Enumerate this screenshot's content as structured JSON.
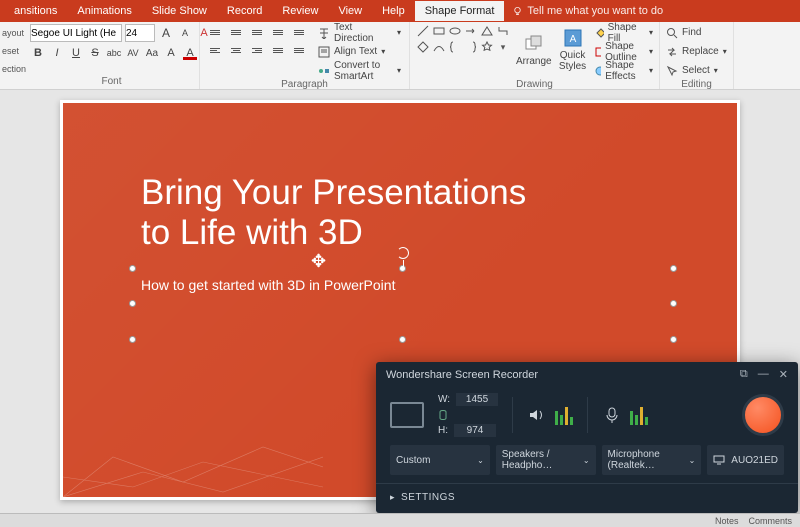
{
  "tabs": {
    "items": [
      "ansitions",
      "Animations",
      "Slide Show",
      "Record",
      "Review",
      "View",
      "Help",
      "Shape Format"
    ],
    "active_index": 7,
    "tell_me": "Tell me what you want to do"
  },
  "left_fragment": {
    "a": "ayout",
    "b": "eset",
    "c": "ection"
  },
  "font": {
    "family": "Segoe UI Light (He",
    "size": "24",
    "label": "Font",
    "btns": {
      "increase": "A",
      "decrease": "A",
      "clear": "A",
      "bold": "B",
      "italic": "I",
      "underline": "U",
      "strike": "S",
      "shadow": "abc",
      "spacing": "AV",
      "case": "Aa",
      "highlight": "A",
      "fontcolor": "A"
    }
  },
  "paragraph": {
    "label": "Paragraph",
    "text_direction": "Text Direction",
    "align_text": "Align Text",
    "convert_smartart": "Convert to SmartArt"
  },
  "drawing": {
    "label": "Drawing",
    "arrange": "Arrange",
    "quick_styles": "Quick Styles",
    "shape_fill": "Shape Fill",
    "shape_outline": "Shape Outline",
    "shape_effects": "Shape Effects"
  },
  "editing": {
    "label": "Editing",
    "find": "Find",
    "replace": "Replace",
    "select": "Select"
  },
  "slide": {
    "title_line1": "Bring Your Presentations",
    "title_line2": "to Life with 3D",
    "subtitle": "How to get started with 3D in PowerPoint"
  },
  "recorder": {
    "title": "Wondershare Screen Recorder",
    "w_label": "W:",
    "h_label": "H:",
    "width": "1455",
    "height": "974",
    "preset_label": "Custom",
    "speaker_label": "Speakers / Headpho…",
    "mic_label": "Microphone (Realtek…",
    "display_label": "AUO21ED",
    "settings": "SETTINGS"
  },
  "status": {
    "notes": "Notes",
    "comments": "Comments"
  }
}
